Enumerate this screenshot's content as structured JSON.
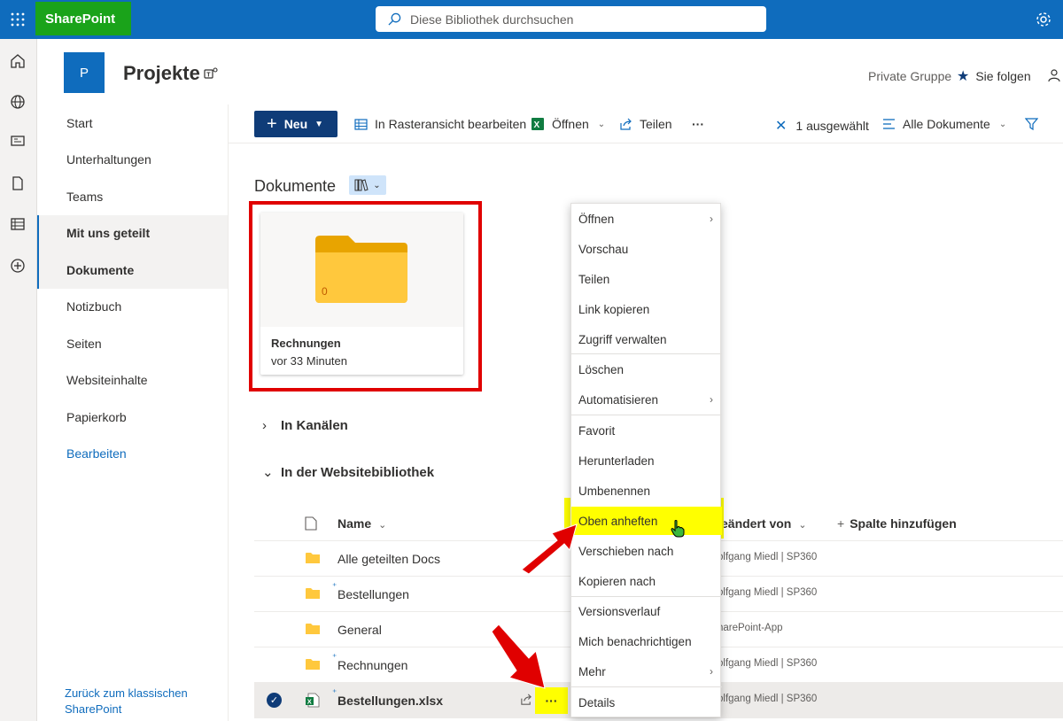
{
  "suite": {
    "brand": "SharePoint",
    "search_placeholder": "Diese Bibliothek durchsuchen"
  },
  "site": {
    "logo_letter": "P",
    "title": "Projekte",
    "group_type": "Private Gruppe",
    "follow_label": "Sie folgen"
  },
  "nav": {
    "items": [
      "Start",
      "Unterhaltungen",
      "Teams",
      "Mit uns geteilt",
      "Dokumente",
      "Notizbuch",
      "Seiten",
      "Websiteinhalte",
      "Papierkorb"
    ],
    "edit": "Bearbeiten",
    "back_classic": "Zurück zum klassischen SharePoint"
  },
  "commands": {
    "new": "Neu",
    "grid_edit": "In Rasteransicht bearbeiten",
    "open": "Öffnen",
    "share": "Teilen",
    "more": "···",
    "selected": "1 ausgewählt",
    "view": "Alle Dokumente"
  },
  "library": {
    "title": "Dokumente",
    "pinned": {
      "name": "Rechnungen",
      "time": "vor 33 Minuten",
      "count": "0"
    },
    "sections": {
      "channels": "In Kanälen",
      "site_library": "In der Websitebibliothek"
    }
  },
  "table": {
    "col_name": "Name",
    "col_modified_by": "eändert von",
    "add_column": "Spalte hinzufügen",
    "rows": [
      {
        "name": "Alle geteilten Docs",
        "modified_by": "olfgang Miedl | SP360"
      },
      {
        "name": "Bestellungen",
        "modified_by": "olfgang Miedl | SP360"
      },
      {
        "name": "General",
        "modified_by": "harePoint-App"
      },
      {
        "name": "Rechnungen",
        "modified_by": "olfgang Miedl | SP360"
      },
      {
        "name": "Bestellungen.xlsx",
        "modified_by": "olfgang Miedl | SP360"
      }
    ]
  },
  "context_menu": {
    "items": [
      "Öffnen",
      "Vorschau",
      "Teilen",
      "Link kopieren",
      "Zugriff verwalten",
      "Löschen",
      "Automatisieren",
      "Favorit",
      "Herunterladen",
      "Umbenennen",
      "Oben anheften",
      "Verschieben nach",
      "Kopieren nach",
      "Versionsverlauf",
      "Mich benachrichtigen",
      "Mehr",
      "Details"
    ],
    "highlighted": "Oben anheften"
  },
  "colors": {
    "suite_bar": "#0f6cbd",
    "brand_highlight": "#1aa31a",
    "highlight": "#ffff00",
    "annotation": "#e00000"
  }
}
